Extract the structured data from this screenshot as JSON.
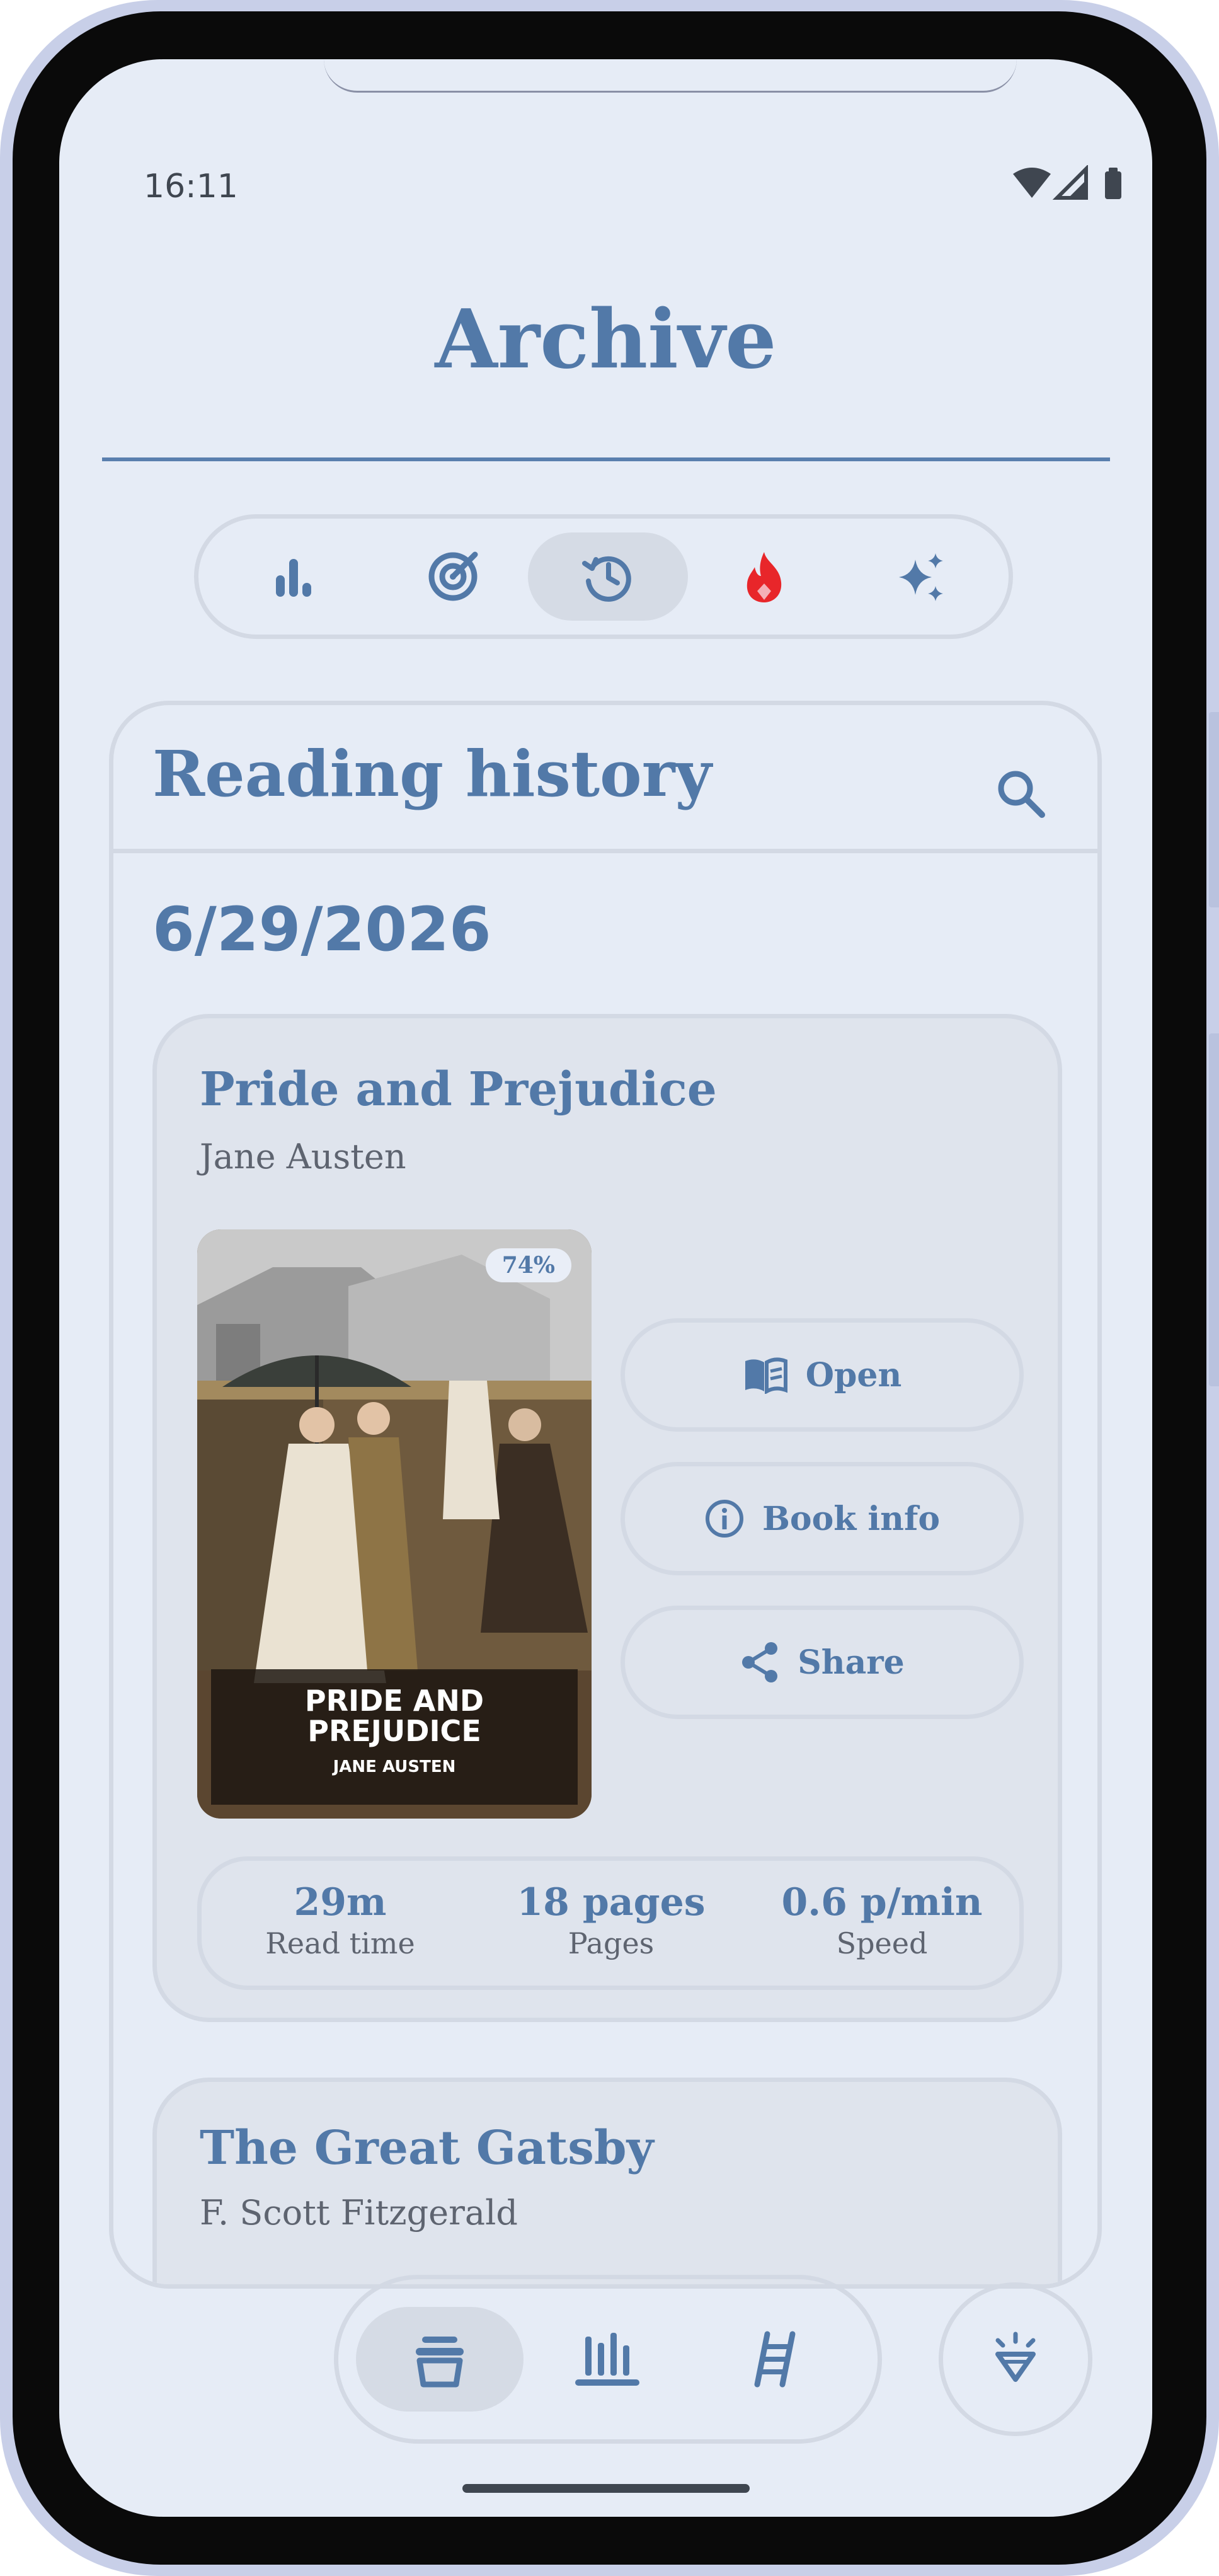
{
  "status_bar": {
    "time": "16:11"
  },
  "header": {
    "title": "Archive"
  },
  "top_tabs": [
    {
      "icon": "bar-chart-icon",
      "active": false
    },
    {
      "icon": "target-icon",
      "active": false
    },
    {
      "icon": "history-icon",
      "active": true
    },
    {
      "icon": "flame-icon",
      "active": false
    },
    {
      "icon": "sparkle-icon",
      "active": false
    }
  ],
  "history": {
    "title": "Reading history",
    "date": "6/29/2026",
    "books": [
      {
        "title": "Pride and Prejudice",
        "author": "Jane Austen",
        "progress": "74%",
        "cover": {
          "title": "PRIDE AND PREJUDICE",
          "author": "JANE AUSTEN"
        },
        "actions": {
          "open": "Open",
          "info": "Book info",
          "share": "Share"
        },
        "stats": [
          {
            "value": "29m",
            "label": "Read time"
          },
          {
            "value": "18 pages",
            "label": "Pages"
          },
          {
            "value": "0.6 p/min",
            "label": "Speed"
          }
        ]
      },
      {
        "title": "The Great Gatsby",
        "author": "F. Scott Fitzgerald"
      }
    ]
  },
  "bottom_nav": [
    {
      "icon": "archive-icon",
      "active": true
    },
    {
      "icon": "library-icon",
      "active": false
    },
    {
      "icon": "ladder-icon",
      "active": false
    }
  ],
  "colors": {
    "accent": "#5279a8",
    "background": "#e6ecf6",
    "flame": "#e8262a"
  }
}
